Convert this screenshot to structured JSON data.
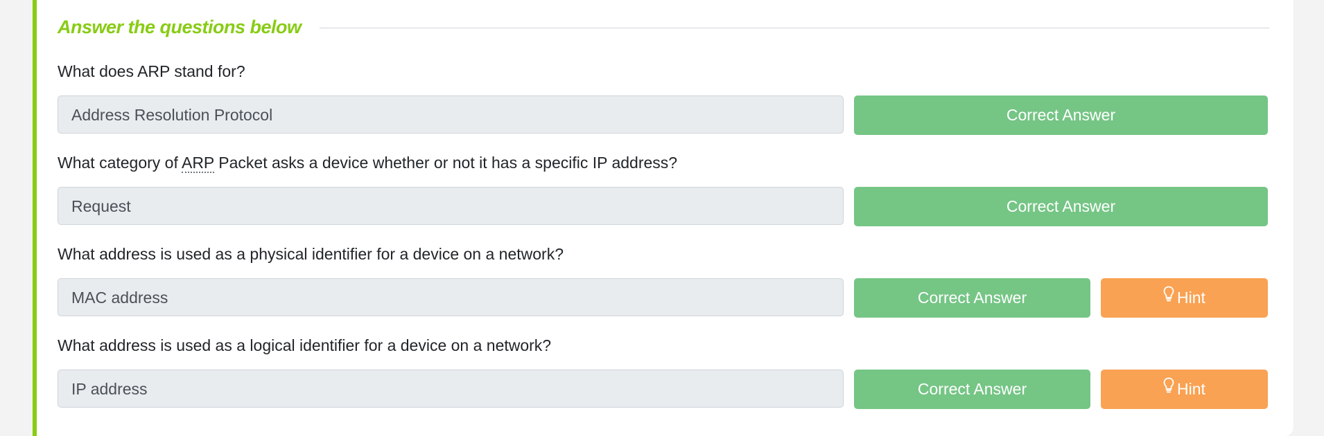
{
  "header": {
    "title": "Answer the questions below"
  },
  "colors": {
    "accent": "#88cc14",
    "correct": "#75c585",
    "hint": "#f9a253"
  },
  "questions": [
    {
      "text": "What does ARP stand for?",
      "answer": "Address Resolution Protocol",
      "button": "Correct Answer",
      "hint": null
    },
    {
      "text_before": "What category of ",
      "text_abbr": "ARP",
      "text_after": " Packet asks a device whether or not it has a specific IP address?",
      "answer": "Request",
      "button": "Correct Answer",
      "hint": null
    },
    {
      "text": "What address is used as a physical identifier for a device on a network?",
      "answer": "MAC address",
      "button": "Correct Answer",
      "hint": "Hint"
    },
    {
      "text": "What address is used as a logical identifier for a device on a network?",
      "answer": "IP address",
      "button": "Correct Answer",
      "hint": "Hint"
    }
  ],
  "icons": {
    "hint": "lightbulb-icon"
  }
}
